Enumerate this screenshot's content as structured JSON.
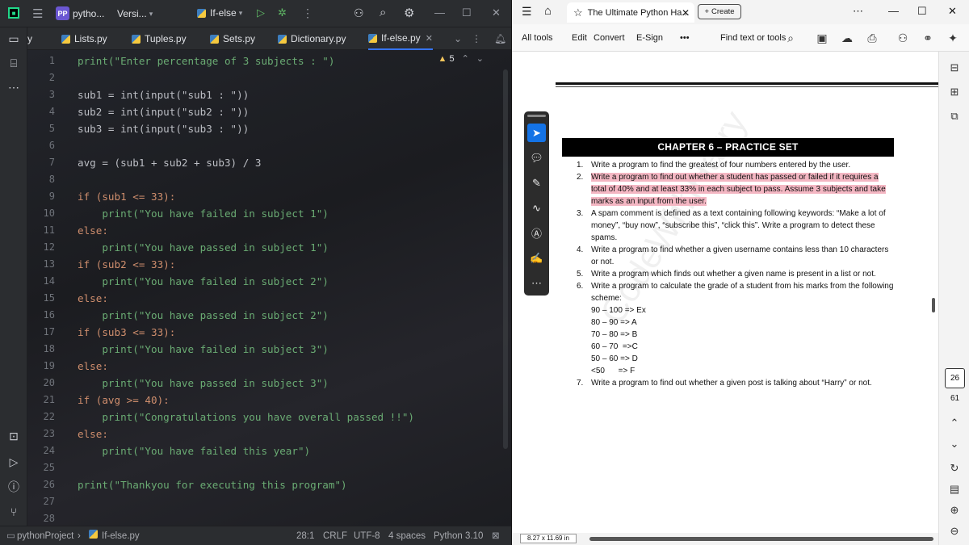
{
  "ide": {
    "title_bar": {
      "project_badge": "PP",
      "project_name": "pytho...",
      "vcs_label": "Versi...",
      "run_config": "If-else"
    },
    "tabs": [
      {
        "label": "y",
        "active": false
      },
      {
        "label": "Lists.py",
        "active": false
      },
      {
        "label": "Tuples.py",
        "active": false
      },
      {
        "label": "Sets.py",
        "active": false
      },
      {
        "label": "Dictionary.py",
        "active": false
      },
      {
        "label": "If-else.py",
        "active": true
      }
    ],
    "warning_count": "5",
    "line_numbers": [
      "1",
      "2",
      "3",
      "4",
      "5",
      "6",
      "7",
      "8",
      "9",
      "10",
      "11",
      "12",
      "13",
      "14",
      "15",
      "16",
      "17",
      "18",
      "19",
      "20",
      "21",
      "22",
      "23",
      "24",
      "25",
      "26",
      "27",
      "28"
    ],
    "code_lines": [
      "print(\"Enter percentage of 3 subjects : \")",
      "",
      "sub1 = int(input(\"sub1 : \"))",
      "sub2 = int(input(\"sub2 : \"))",
      "sub3 = int(input(\"sub3 : \"))",
      "",
      "avg = (sub1 + sub2 + sub3) / 3",
      "",
      "if (sub1 <= 33):",
      "    print(\"You have failed in subject 1\")",
      "else:",
      "    print(\"You have passed in subject 1\")",
      "if (sub2 <= 33):",
      "    print(\"You have failed in subject 2\")",
      "else:",
      "    print(\"You have passed in subject 2\")",
      "if (sub3 <= 33):",
      "    print(\"You have failed in subject 3\")",
      "else:",
      "    print(\"You have passed in subject 3\")",
      "if (avg >= 40):",
      "    print(\"Congratulations you have overall passed !!\")",
      "else:",
      "    print(\"You have failed this year\")",
      "",
      "print(\"Thankyou for executing this program\")",
      "",
      ""
    ],
    "status_bar": {
      "project": "pythonProject",
      "file": "If-else.py",
      "cursor": "28:1",
      "line_ending": "CRLF",
      "encoding": "UTF-8",
      "indent": "4 spaces",
      "interpreter": "Python 3.10"
    }
  },
  "pdf": {
    "tab_title": "The Ultimate Python Ha...",
    "create_label": "Create",
    "toolbar": {
      "all_tools": "All tools",
      "edit": "Edit",
      "convert": "Convert",
      "esign": "E-Sign",
      "more": "•••",
      "find": "Find text or tools"
    },
    "chapter_title": "CHAPTER 6 – PRACTICE SET",
    "items": [
      {
        "num": "1.",
        "text": "Write a program to find the greatest of four numbers entered by the user."
      },
      {
        "num": "2.",
        "text": "Write a program to find out whether a student has passed or failed if it requires a total of 40% and at least 33% in each subject to pass. Assume 3 subjects and take marks as an input from the user."
      },
      {
        "num": "3.",
        "text": "A spam comment is defined as a text containing following keywords: “Make a lot of money”, “buy now”, “subscribe this”, “click this”. Write a program to detect these spams."
      },
      {
        "num": "4.",
        "text": "Write a program to find whether a given username contains less than 10 characters or not."
      },
      {
        "num": "5.",
        "text": "Write a program which finds out whether a given name is present in a list or not."
      },
      {
        "num": "6.",
        "text": "Write a program to calculate the grade of a student from his marks from the following scheme:"
      },
      {
        "num": "7.",
        "text": "Write a program to find out whether a given post is talking about “Harry” or not."
      }
    ],
    "grade_scheme": [
      "90 – 100 => Ex",
      "80 – 90 => A",
      "70 – 80 => B",
      "60 – 70  =>C",
      "50 – 60 => D",
      "<50      => F"
    ],
    "watermark": "CodeWithHarry",
    "page_current": "26",
    "page_total": "61",
    "page_size": "8.27 x 11.69 in",
    "highlight_color": "#f4b7c3"
  }
}
